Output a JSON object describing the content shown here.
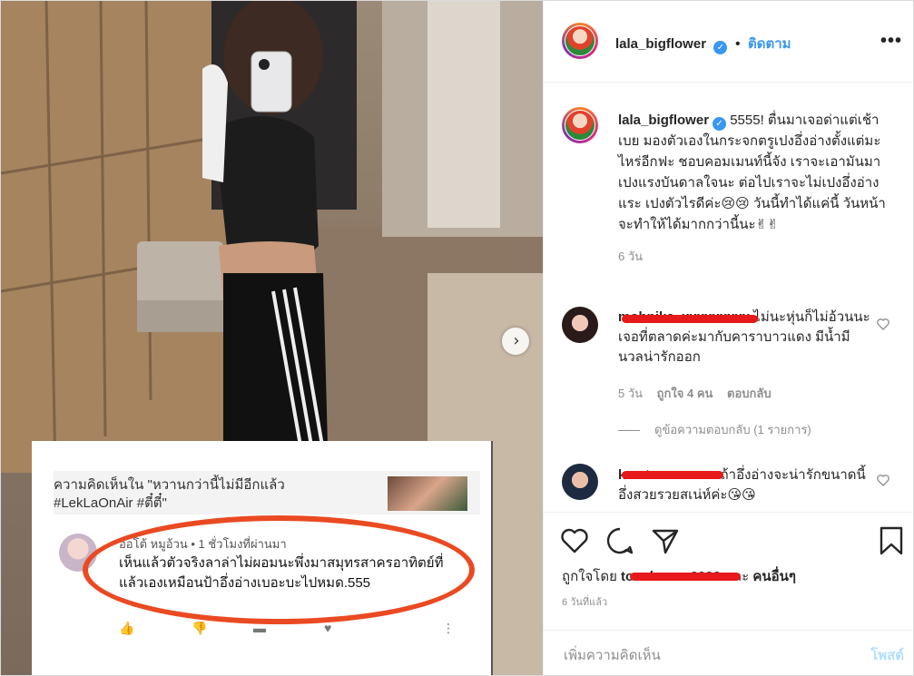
{
  "post": {
    "username": "lala_bigflower",
    "follow_label": "ติดตาม",
    "dot": "•",
    "more_label": "•••",
    "caption": "5555! ตื่นมาเจอด่าแต่เช้าเบย มองตัวเองในกระจกตรูเปงอึ่งอ่างตั้งแต่มะไหร่อีกฟะ ชอบคอมเมนท์นี้จัง เราจะเอามันมาเปงแรงบันดาลใจนะ ต่อไปเราจะไม่เปงอึ่งอ่างแระ เปงตัวไรดีค่ะ😢😢 วันนี้ทำได้แค่นี้ วันหน้าจะทำให้ได้มากกว่านี้นะ✌✌",
    "caption_time": "6 วัน"
  },
  "comments": [
    {
      "text": "ไม่นะหุ่นก็ไม่อ้วนนะเจอที่ตลาดค่ะมากับคาราบาวแดง มีน้ำมีนวลน่ารักออก",
      "time": "5 วัน",
      "likes": "ถูกใจ 4 คน",
      "reply": "ตอบกลับ",
      "view_replies": "ดูข้อความตอบกลับ (1 รายการ)"
    },
    {
      "text": "ถ้าอึ่งอ่างจะน่ารักขนาดนี้ อึ่งสวยรวยสเน่ห์ค่ะ😘😘"
    }
  ],
  "footer": {
    "liked_by_prefix": "ถูกใจโดย",
    "liked_user": "tonchanon9999",
    "liked_suffix_and": "และ",
    "liked_others": "คนอื่นๆ",
    "posted_time": "6 วันที่แล้ว",
    "add_comment_placeholder": "เพิ่มความคิดเห็น",
    "post_label": "โพสต์"
  },
  "photo_card": {
    "context": "ความคิดเห็นใน \"หวานกว่านี้ไม่มีอีกแล้ว #LekLaOnAir #ตี๋ตี๋\"",
    "commenter_meta": "ออโต้ หมูอ้วน • 1 ชั่วโมงที่ผ่านมา",
    "comment": "เห็นแล้วตัวจริงลาล่าไม่ผอมนะพึ่งมาสมุทรสาครอาทิตย์ที่แล้วเองเหมือนป้าอึ่งอ่างเบอะบะไปหมด.555"
  },
  "colors": {
    "link": "#3897f0",
    "muted": "#8e8e8e",
    "text": "#262626",
    "ellipse": "#ea4a22",
    "redaction": "#e8191b"
  },
  "icons": [
    "next-arrow-icon",
    "verified-badge-icon",
    "more-options-icon",
    "heart-icon",
    "comment-icon",
    "share-icon",
    "bookmark-icon",
    "like-icon",
    "dislike-icon",
    "reply-icon"
  ]
}
